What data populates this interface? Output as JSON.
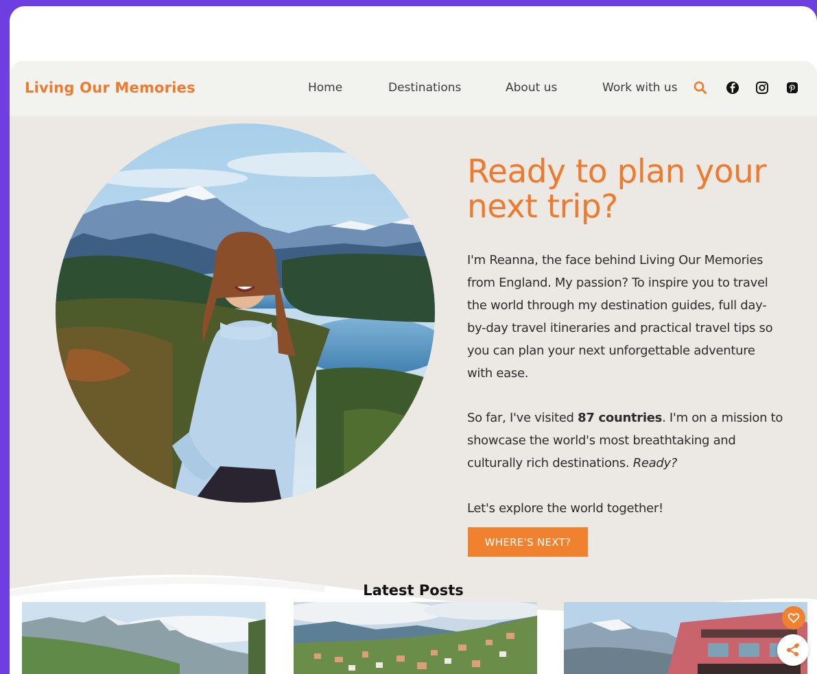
{
  "header": {
    "logo": "Living Our Memories",
    "nav": [
      {
        "label": "Home"
      },
      {
        "label": "Destinations"
      },
      {
        "label": "About us"
      },
      {
        "label": "Work with us"
      }
    ],
    "icons": [
      "search-icon",
      "facebook-icon",
      "instagram-icon",
      "pinterest-icon"
    ]
  },
  "hero": {
    "title_line1": "Ready to plan your",
    "title_line2": "next trip?",
    "intro": [
      "I'm Reanna, the face behind Living Our Memories",
      "from England. My passion? To inspire you to travel",
      "the world through my destination guides, full day-",
      "by-day travel itineraries and practical travel tips so",
      "you can plan your next unforgettable adventure",
      "with ease."
    ],
    "visited_prefix": "So far, I've visited ",
    "visited_count": "87 countries",
    "visited_suffix": ". I'm on a mission to",
    "visited_line2": "showcase the world's most breathtaking and",
    "visited_line3_prefix": "culturally rich destinations. ",
    "visited_line3_em": "Ready?",
    "closing": "Let's explore the world together!",
    "cta_label": "WHERE'S NEXT?"
  },
  "latest": {
    "title": "Latest Posts"
  },
  "colors": {
    "accent": "#ee7a2e",
    "background": "#ece8e4",
    "frame": "#6d3fe0"
  }
}
